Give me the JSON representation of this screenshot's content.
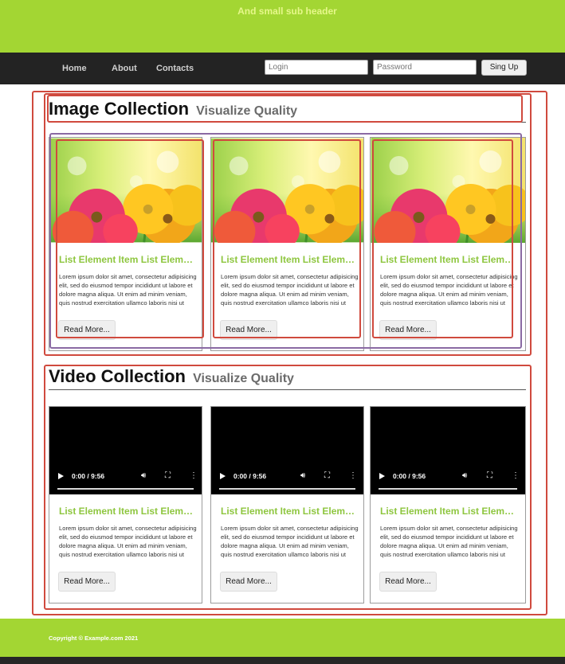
{
  "header": {
    "sub_header": "And small sub header"
  },
  "nav": {
    "links": [
      "Home",
      "About",
      "Contacts"
    ],
    "login_placeholder": "Login",
    "password_placeholder": "Password",
    "signup_label": "Sing Up"
  },
  "image_section": {
    "title": "Image Collection",
    "subtitle": "Visualize Quality"
  },
  "video_section": {
    "title": "Video Collection",
    "subtitle": "Visualize Quality"
  },
  "card": {
    "title": "List Element Item List Element Item",
    "text": "Lorem ipsum dolor sit amet, consectetur adipisicing elit, sed do eiusmod tempor incididunt ut labore et dolore magna aliqua. Ut enim ad minim veniam, quis nostrud exercitation ullamco laboris nisi ut aliquip ex ea commodo consequat.",
    "button_label": "Read More..."
  },
  "video": {
    "time": "0:00 / 9:56",
    "icons": [
      "play-icon",
      "volume-icon",
      "fullscreen-icon",
      "more-options-icon"
    ]
  },
  "footer": {
    "copyright": "Copyright © Example.com 2021"
  },
  "colors": {
    "accent": "#a3d633",
    "nav_bg": "#232323",
    "card_title": "#8ec63f",
    "annotation_red": "#d04a3e",
    "annotation_purple": "#8a6aa3"
  }
}
